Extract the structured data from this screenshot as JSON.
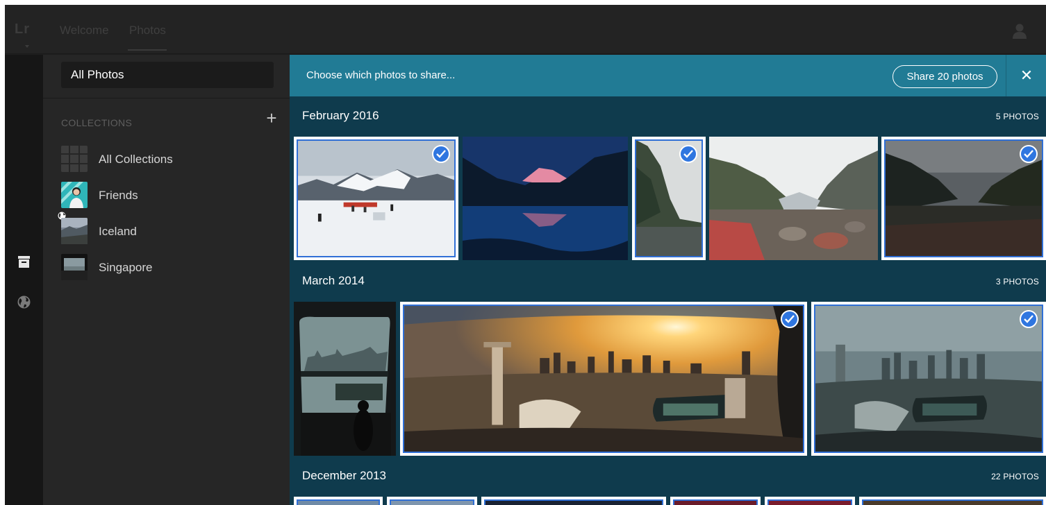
{
  "topbar": {
    "logo": "Lr",
    "tabs": [
      {
        "label": "Welcome",
        "active": false
      },
      {
        "label": "Photos",
        "active": true
      }
    ],
    "user_icon": "user-icon"
  },
  "rail": {
    "icons": [
      "archive-icon",
      "globe-icon"
    ]
  },
  "sidebar": {
    "all_photos": "All Photos",
    "collections_header": "COLLECTIONS",
    "add_icon": "plus-icon",
    "collections": [
      {
        "label": "All Collections",
        "thumb": "grid-icon"
      },
      {
        "label": "Friends",
        "thumb": "photo"
      },
      {
        "label": "Iceland",
        "thumb": "photo",
        "shared": true
      },
      {
        "label": "Singapore",
        "thumb": "photo"
      }
    ]
  },
  "share_bar": {
    "prompt": "Choose which photos to share...",
    "button": "Share 20 photos",
    "close_icon": "close-icon",
    "close_glyph": "✕"
  },
  "sections": [
    {
      "title": "February 2016",
      "count": "5 PHOTOS",
      "photos": [
        {
          "subject": "snowy mountain with red plane",
          "selected": true
        },
        {
          "subject": "mountain peak at dusk reflected in lake",
          "selected": false
        },
        {
          "subject": "misty fjord cliff",
          "selected": true
        },
        {
          "subject": "rocky glacier valley",
          "selected": false
        },
        {
          "subject": "dark cloudy valley",
          "selected": true
        }
      ]
    },
    {
      "title": "March 2014",
      "count": "3 PHOTOS",
      "photos": [
        {
          "subject": "person in observation capsule window",
          "selected": false
        },
        {
          "subject": "golden sunset city skyline from capsule",
          "selected": true
        },
        {
          "subject": "hazy city skyline from capsule",
          "selected": true
        }
      ]
    },
    {
      "title": "December 2013",
      "count": "22 PHOTOS",
      "photos": []
    }
  ],
  "colors": {
    "share_bar": "#217b95",
    "main_bg": "#0f3b4d",
    "check": "#2f76e0",
    "sidebar": "#262626"
  }
}
